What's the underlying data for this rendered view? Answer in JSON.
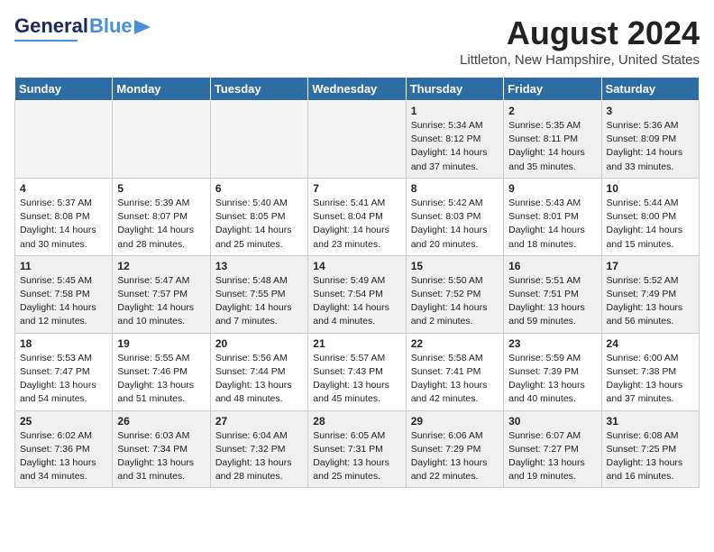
{
  "header": {
    "logo_general": "General",
    "logo_blue": "Blue",
    "month_year": "August 2024",
    "location": "Littleton, New Hampshire, United States"
  },
  "weekdays": [
    "Sunday",
    "Monday",
    "Tuesday",
    "Wednesday",
    "Thursday",
    "Friday",
    "Saturday"
  ],
  "weeks": [
    [
      {
        "day": "",
        "info": ""
      },
      {
        "day": "",
        "info": ""
      },
      {
        "day": "",
        "info": ""
      },
      {
        "day": "",
        "info": ""
      },
      {
        "day": "1",
        "info": "Sunrise: 5:34 AM\nSunset: 8:12 PM\nDaylight: 14 hours\nand 37 minutes."
      },
      {
        "day": "2",
        "info": "Sunrise: 5:35 AM\nSunset: 8:11 PM\nDaylight: 14 hours\nand 35 minutes."
      },
      {
        "day": "3",
        "info": "Sunrise: 5:36 AM\nSunset: 8:09 PM\nDaylight: 14 hours\nand 33 minutes."
      }
    ],
    [
      {
        "day": "4",
        "info": "Sunrise: 5:37 AM\nSunset: 8:08 PM\nDaylight: 14 hours\nand 30 minutes."
      },
      {
        "day": "5",
        "info": "Sunrise: 5:39 AM\nSunset: 8:07 PM\nDaylight: 14 hours\nand 28 minutes."
      },
      {
        "day": "6",
        "info": "Sunrise: 5:40 AM\nSunset: 8:05 PM\nDaylight: 14 hours\nand 25 minutes."
      },
      {
        "day": "7",
        "info": "Sunrise: 5:41 AM\nSunset: 8:04 PM\nDaylight: 14 hours\nand 23 minutes."
      },
      {
        "day": "8",
        "info": "Sunrise: 5:42 AM\nSunset: 8:03 PM\nDaylight: 14 hours\nand 20 minutes."
      },
      {
        "day": "9",
        "info": "Sunrise: 5:43 AM\nSunset: 8:01 PM\nDaylight: 14 hours\nand 18 minutes."
      },
      {
        "day": "10",
        "info": "Sunrise: 5:44 AM\nSunset: 8:00 PM\nDaylight: 14 hours\nand 15 minutes."
      }
    ],
    [
      {
        "day": "11",
        "info": "Sunrise: 5:45 AM\nSunset: 7:58 PM\nDaylight: 14 hours\nand 12 minutes."
      },
      {
        "day": "12",
        "info": "Sunrise: 5:47 AM\nSunset: 7:57 PM\nDaylight: 14 hours\nand 10 minutes."
      },
      {
        "day": "13",
        "info": "Sunrise: 5:48 AM\nSunset: 7:55 PM\nDaylight: 14 hours\nand 7 minutes."
      },
      {
        "day": "14",
        "info": "Sunrise: 5:49 AM\nSunset: 7:54 PM\nDaylight: 14 hours\nand 4 minutes."
      },
      {
        "day": "15",
        "info": "Sunrise: 5:50 AM\nSunset: 7:52 PM\nDaylight: 14 hours\nand 2 minutes."
      },
      {
        "day": "16",
        "info": "Sunrise: 5:51 AM\nSunset: 7:51 PM\nDaylight: 13 hours\nand 59 minutes."
      },
      {
        "day": "17",
        "info": "Sunrise: 5:52 AM\nSunset: 7:49 PM\nDaylight: 13 hours\nand 56 minutes."
      }
    ],
    [
      {
        "day": "18",
        "info": "Sunrise: 5:53 AM\nSunset: 7:47 PM\nDaylight: 13 hours\nand 54 minutes."
      },
      {
        "day": "19",
        "info": "Sunrise: 5:55 AM\nSunset: 7:46 PM\nDaylight: 13 hours\nand 51 minutes."
      },
      {
        "day": "20",
        "info": "Sunrise: 5:56 AM\nSunset: 7:44 PM\nDaylight: 13 hours\nand 48 minutes."
      },
      {
        "day": "21",
        "info": "Sunrise: 5:57 AM\nSunset: 7:43 PM\nDaylight: 13 hours\nand 45 minutes."
      },
      {
        "day": "22",
        "info": "Sunrise: 5:58 AM\nSunset: 7:41 PM\nDaylight: 13 hours\nand 42 minutes."
      },
      {
        "day": "23",
        "info": "Sunrise: 5:59 AM\nSunset: 7:39 PM\nDaylight: 13 hours\nand 40 minutes."
      },
      {
        "day": "24",
        "info": "Sunrise: 6:00 AM\nSunset: 7:38 PM\nDaylight: 13 hours\nand 37 minutes."
      }
    ],
    [
      {
        "day": "25",
        "info": "Sunrise: 6:02 AM\nSunset: 7:36 PM\nDaylight: 13 hours\nand 34 minutes."
      },
      {
        "day": "26",
        "info": "Sunrise: 6:03 AM\nSunset: 7:34 PM\nDaylight: 13 hours\nand 31 minutes."
      },
      {
        "day": "27",
        "info": "Sunrise: 6:04 AM\nSunset: 7:32 PM\nDaylight: 13 hours\nand 28 minutes."
      },
      {
        "day": "28",
        "info": "Sunrise: 6:05 AM\nSunset: 7:31 PM\nDaylight: 13 hours\nand 25 minutes."
      },
      {
        "day": "29",
        "info": "Sunrise: 6:06 AM\nSunset: 7:29 PM\nDaylight: 13 hours\nand 22 minutes."
      },
      {
        "day": "30",
        "info": "Sunrise: 6:07 AM\nSunset: 7:27 PM\nDaylight: 13 hours\nand 19 minutes."
      },
      {
        "day": "31",
        "info": "Sunrise: 6:08 AM\nSunset: 7:25 PM\nDaylight: 13 hours\nand 16 minutes."
      }
    ]
  ]
}
